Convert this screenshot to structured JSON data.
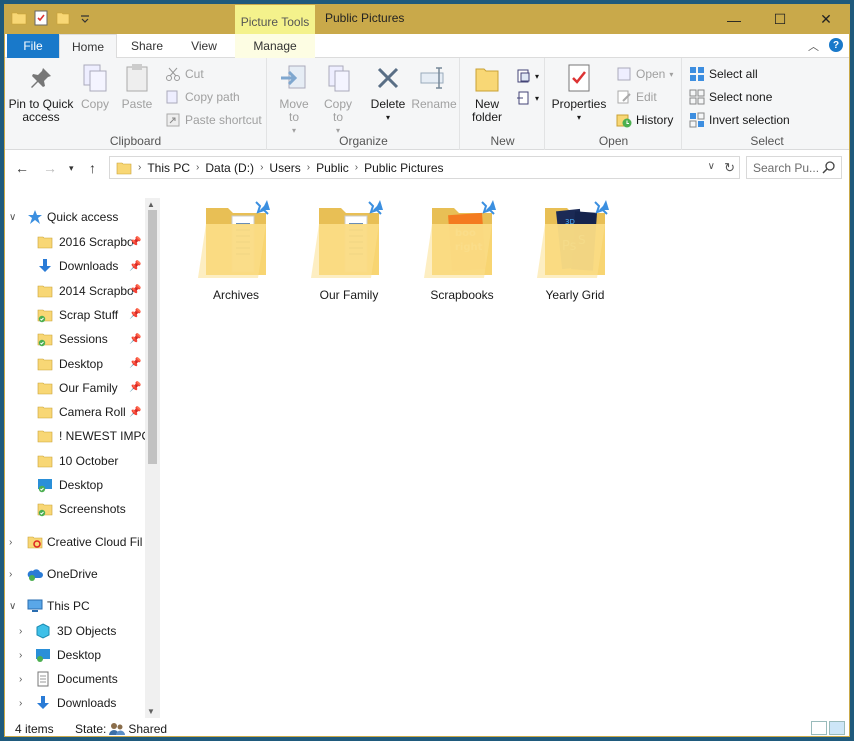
{
  "window": {
    "title": "Public Pictures",
    "context_tab_header": "Picture Tools",
    "controls": {
      "minimize": "—",
      "maximize": "☐",
      "close": "✕"
    }
  },
  "tabs": {
    "file": "File",
    "home": "Home",
    "share": "Share",
    "view": "View",
    "manage": "Manage"
  },
  "ribbon": {
    "clipboard": {
      "label": "Clipboard",
      "pin": "Pin to Quick access",
      "copy": "Copy",
      "paste": "Paste",
      "cut": "Cut",
      "copy_path": "Copy path",
      "paste_shortcut": "Paste shortcut"
    },
    "organize": {
      "label": "Organize",
      "move_to": "Move to",
      "copy_to": "Copy to",
      "delete": "Delete",
      "rename": "Rename"
    },
    "new": {
      "label": "New",
      "new_folder": "New folder"
    },
    "open": {
      "label": "Open",
      "properties": "Properties",
      "open": "Open",
      "edit": "Edit",
      "history": "History"
    },
    "select": {
      "label": "Select",
      "select_all": "Select all",
      "select_none": "Select none",
      "invert": "Invert selection"
    }
  },
  "address": {
    "crumbs": [
      "This PC",
      "Data (D:)",
      "Users",
      "Public",
      "Public Pictures"
    ],
    "search_placeholder": "Search Pu..."
  },
  "nav": {
    "quick_access": "Quick access",
    "quick_items": [
      {
        "label": "2016 Scrapbo",
        "icon": "folder",
        "pinned": true
      },
      {
        "label": "Downloads",
        "icon": "downloads",
        "pinned": true
      },
      {
        "label": "2014 Scrapbo",
        "icon": "folder",
        "pinned": true
      },
      {
        "label": "Scrap Stuff",
        "icon": "folder-sync",
        "pinned": true
      },
      {
        "label": "Sessions",
        "icon": "folder-sync",
        "pinned": true
      },
      {
        "label": "Desktop",
        "icon": "folder",
        "pinned": true
      },
      {
        "label": "Our Family",
        "icon": "folder",
        "pinned": true
      },
      {
        "label": "Camera Roll",
        "icon": "folder",
        "pinned": true
      },
      {
        "label": "! NEWEST IMPOI",
        "icon": "folder",
        "pinned": false
      },
      {
        "label": "10 October",
        "icon": "folder",
        "pinned": false
      },
      {
        "label": "Desktop",
        "icon": "desktop-sync",
        "pinned": false
      },
      {
        "label": "Screenshots",
        "icon": "folder-sync",
        "pinned": false
      }
    ],
    "creative_cloud": "Creative Cloud Fil",
    "onedrive": "OneDrive",
    "this_pc": "This PC",
    "pc_items": [
      "3D Objects",
      "Desktop",
      "Documents",
      "Downloads"
    ]
  },
  "items": [
    {
      "label": "Archives",
      "preview": "docs"
    },
    {
      "label": "Our Family",
      "preview": "docs"
    },
    {
      "label": "Scrapbooks",
      "preview": "orange"
    },
    {
      "label": "Yearly Grid",
      "preview": "ps"
    }
  ],
  "status": {
    "count": "4 items",
    "state_label": "State:",
    "state_value": "Shared"
  },
  "colors": {
    "title_bar": "#c9a94a",
    "file_tab": "#1979ca",
    "context_tab": "#f4f28c",
    "folder": "#f8d775"
  }
}
